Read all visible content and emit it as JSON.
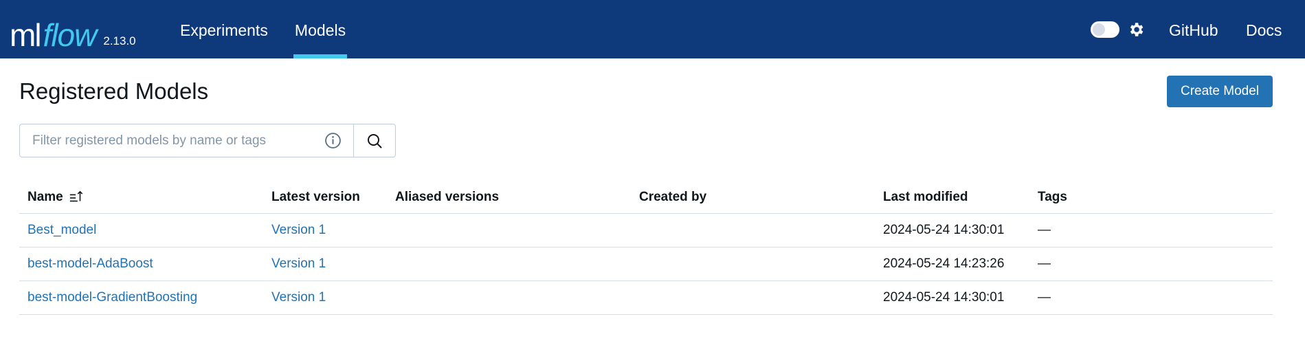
{
  "header": {
    "logo_ml": "ml",
    "logo_flow": "flow",
    "version": "2.13.0",
    "nav": {
      "experiments": "Experiments",
      "models": "Models",
      "github": "GitHub",
      "docs": "Docs"
    },
    "active_tab": "Models",
    "theme_toggle_on": false,
    "colors": {
      "bar": "#0e3a7b",
      "accent": "#43c9ed"
    }
  },
  "page": {
    "title": "Registered Models",
    "create_button": "Create Model",
    "search": {
      "placeholder": "Filter registered models by name or tags",
      "value": ""
    }
  },
  "table": {
    "columns": {
      "name": "Name",
      "latest": "Latest version",
      "aliased": "Aliased versions",
      "created": "Created by",
      "modified": "Last modified",
      "tags": "Tags"
    },
    "sort": {
      "column": "Name",
      "direction": "ascending"
    },
    "rows": [
      {
        "name": "Best_model",
        "latest": "Version 1",
        "aliased": "",
        "created": "",
        "modified": "2024-05-24 14:30:01",
        "tags": "—"
      },
      {
        "name": "best-model-AdaBoost",
        "latest": "Version 1",
        "aliased": "",
        "created": "",
        "modified": "2024-05-24 14:23:26",
        "tags": "—"
      },
      {
        "name": "best-model-GradientBoosting",
        "latest": "Version 1",
        "aliased": "",
        "created": "",
        "modified": "2024-05-24 14:30:01",
        "tags": "—"
      }
    ]
  },
  "colors": {
    "link": "#2272b4",
    "primary_button": "#2272b4"
  }
}
